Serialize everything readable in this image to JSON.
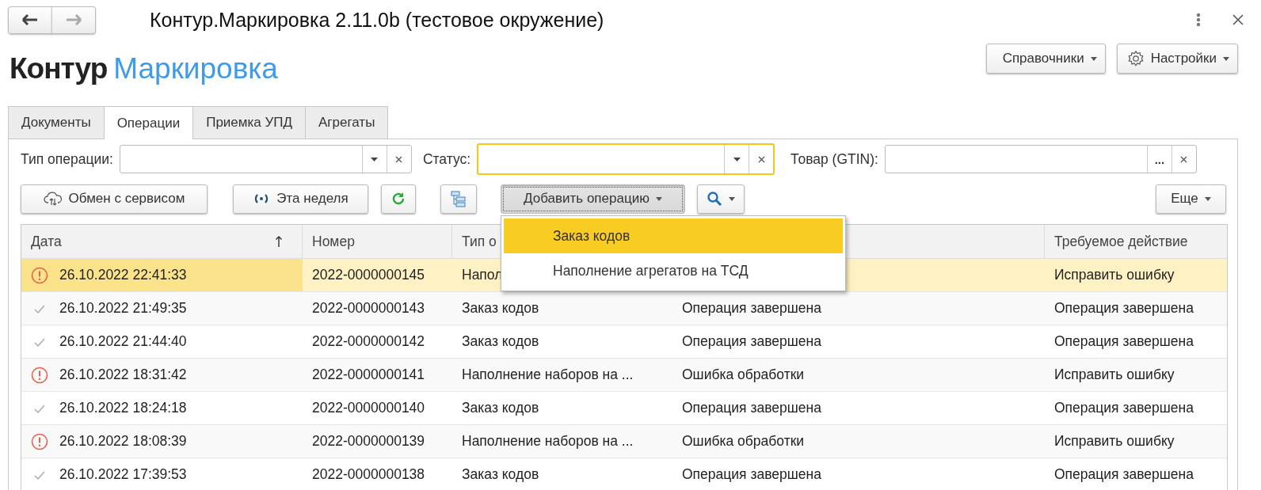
{
  "window": {
    "title": "Контур.Маркировка 2.11.0b (тестовое окружение)",
    "nav": [
      {
        "kind": "back",
        "disabled": false
      },
      {
        "kind": "forward",
        "disabled": true
      }
    ]
  },
  "logo": {
    "brand": "Контур",
    "product": "Маркировка"
  },
  "header_buttons": [
    {
      "kind": "plain",
      "label": "Справочники"
    },
    {
      "kind": "settings",
      "label": "Настройки"
    }
  ],
  "tabs": [
    {
      "label": "Документы",
      "selected": false
    },
    {
      "label": "Операции",
      "selected": true
    },
    {
      "label": "Приемка УПД",
      "selected": false
    },
    {
      "label": "Агрегаты",
      "selected": false
    }
  ],
  "filters": [
    {
      "label": "Тип операции:",
      "kind": "dropdown",
      "focused": false
    },
    {
      "label": "Статус:",
      "kind": "dropdown",
      "focused": true
    },
    {
      "label": "Товар (GTIN):",
      "kind": "choice",
      "choose_button": "...",
      "focused": false
    }
  ],
  "toolbar": [
    {
      "kind": "sync",
      "label": "Обмен с сервисом",
      "pressed": false
    },
    {
      "kind": "period",
      "label": "Эта неделя",
      "pressed": false
    },
    {
      "kind": "refresh",
      "pressed": false
    },
    {
      "kind": "tree",
      "pressed": false
    },
    {
      "kind": "add",
      "label": "Добавить операцию",
      "pressed": true
    },
    {
      "kind": "search",
      "pressed": false
    },
    {
      "kind": "more",
      "label": "Еще",
      "pressed": false
    }
  ],
  "table": {
    "columns": [
      {
        "label": "Дата",
        "sorted": true
      },
      {
        "label": "Номер",
        "sorted": false
      },
      {
        "label": "Тип о",
        "sorted": false
      },
      {
        "sorted": false
      },
      {
        "label": "Требуемое действие",
        "sorted": false
      }
    ],
    "rows": [
      {
        "kind": "error",
        "selected": true,
        "date": "26.10.2022 22:41:33",
        "number": "2022-0000000145",
        "type": "Напол",
        "action": "Исправить ошибку"
      },
      {
        "kind": "done",
        "selected": false,
        "date": "26.10.2022 21:49:35",
        "number": "2022-0000000143",
        "type": "Заказ кодов",
        "status": "Операция завершена",
        "action": "Операция завершена"
      },
      {
        "kind": "done",
        "selected": false,
        "date": "26.10.2022 21:44:40",
        "number": "2022-0000000142",
        "type": "Заказ кодов",
        "status": "Операция завершена",
        "action": "Операция завершена"
      },
      {
        "kind": "error",
        "selected": false,
        "date": "26.10.2022 18:31:42",
        "number": "2022-0000000141",
        "type": "Наполнение наборов на ...",
        "status": "Ошибка обработки",
        "action": "Исправить ошибку"
      },
      {
        "kind": "done",
        "selected": false,
        "date": "26.10.2022 18:24:18",
        "number": "2022-0000000140",
        "type": "Заказ кодов",
        "status": "Операция завершена",
        "action": "Операция завершена"
      },
      {
        "kind": "error",
        "selected": false,
        "date": "26.10.2022 18:08:39",
        "number": "2022-0000000139",
        "type": "Наполнение наборов на ...",
        "status": "Ошибка обработки",
        "action": "Исправить ошибку"
      },
      {
        "kind": "done",
        "selected": false,
        "date": "26.10.2022 17:39:53",
        "number": "2022-0000000138",
        "type": "Заказ кодов",
        "status": "Операция завершена",
        "action": "Операция завершена"
      }
    ]
  },
  "menu": {
    "items": [
      {
        "label": "Заказ кодов",
        "selected": true
      },
      {
        "label": "Наполнение агрегатов на ТСД",
        "selected": false
      }
    ]
  }
}
